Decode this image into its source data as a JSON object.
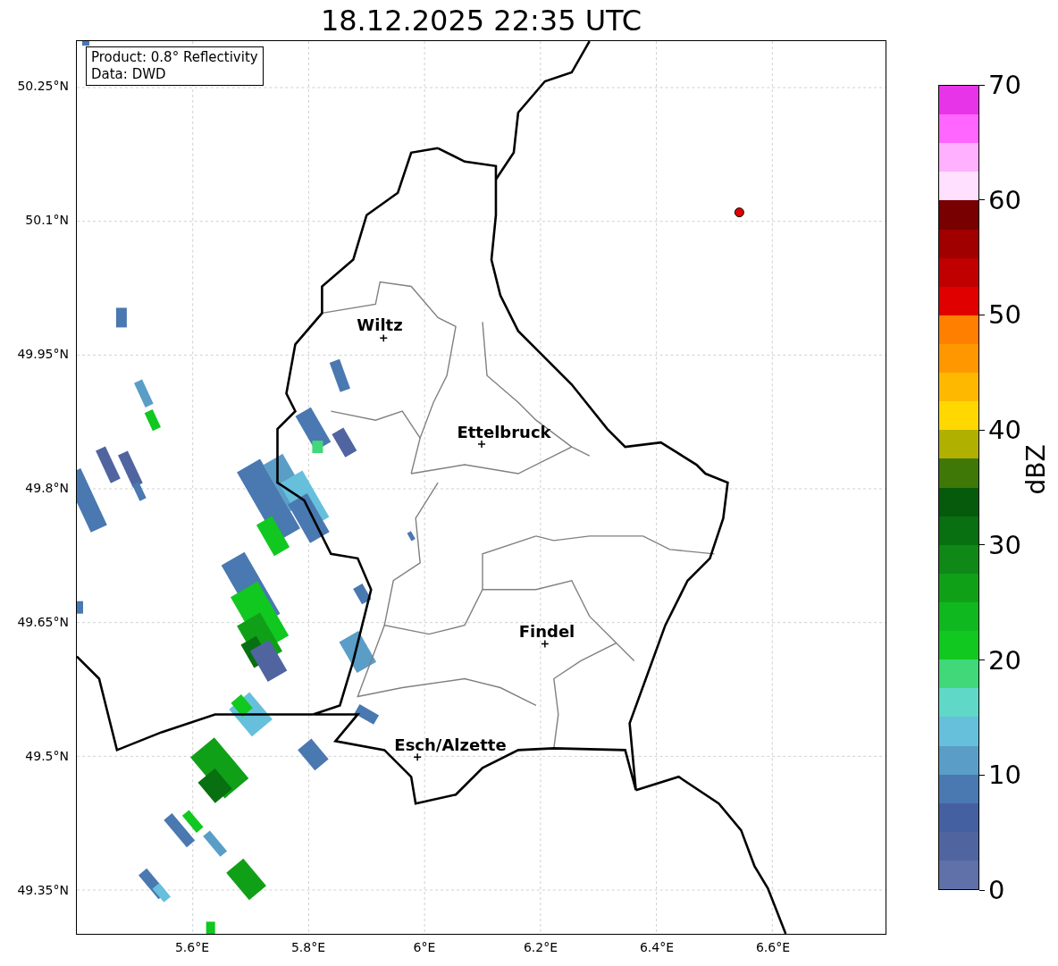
{
  "title": "18.12.2025 22:35 UTC",
  "info_box": [
    "Product: 0.8° Reflectivity",
    "Data: DWD"
  ],
  "lat_ticks": [
    "50.25°N",
    "50.1°N",
    "49.95°N",
    "49.8°N",
    "49.65°N",
    "49.5°N",
    "49.35°N"
  ],
  "lon_ticks": [
    "5.6°E",
    "5.8°E",
    "6°E",
    "6.2°E",
    "6.4°E",
    "6.6°E"
  ],
  "cities": [
    {
      "name": "Wiltz"
    },
    {
      "name": "Ettelbruck"
    },
    {
      "name": "Findel"
    },
    {
      "name": "Esch/Alzette"
    }
  ],
  "colorbar": {
    "label": "dBZ",
    "ticks": [
      "70",
      "60",
      "50",
      "40",
      "30",
      "20",
      "10",
      "0"
    ],
    "bands": [
      {
        "color": "#e834e8"
      },
      {
        "color": "#ff66ff"
      },
      {
        "color": "#ffb0ff"
      },
      {
        "color": "#ffe0ff"
      },
      {
        "color": "#780000"
      },
      {
        "color": "#a00000"
      },
      {
        "color": "#c00000"
      },
      {
        "color": "#e00000"
      },
      {
        "color": "#ff7f00"
      },
      {
        "color": "#ff9800"
      },
      {
        "color": "#ffb800"
      },
      {
        "color": "#ffd800"
      },
      {
        "color": "#b0b000"
      },
      {
        "color": "#407808"
      },
      {
        "color": "#065a0c"
      },
      {
        "color": "#087010"
      },
      {
        "color": "#108818"
      },
      {
        "color": "#10a018"
      },
      {
        "color": "#10b820"
      },
      {
        "color": "#10c820"
      },
      {
        "color": "#40d878"
      },
      {
        "color": "#60d8c8"
      },
      {
        "color": "#66c0dc"
      },
      {
        "color": "#5a9ec8"
      },
      {
        "color": "#4a78b0"
      },
      {
        "color": "#4560a0"
      },
      {
        "color": "#5065a0"
      },
      {
        "color": "#6070a8"
      }
    ]
  }
}
